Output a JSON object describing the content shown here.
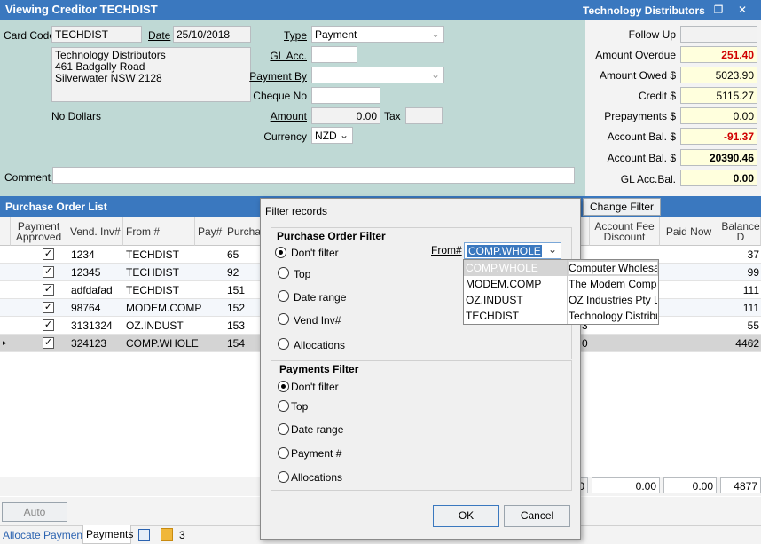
{
  "title": "Viewing Creditor TECHDIST",
  "company": "Technology Distributors",
  "form": {
    "card_code_label": "Card Code",
    "card_code": "TECHDIST",
    "date_label": "Date",
    "date": "25/10/2018",
    "address": [
      "Technology Distributors",
      "461 Badgally Road",
      "Silverwater NSW 2128"
    ],
    "no_dollars": "No Dollars",
    "type_label": "Type",
    "type": "Payment",
    "gl_acc_label": "GL Acc.",
    "payment_by_label": "Payment By",
    "cheque_no_label": "Cheque No",
    "amount_label": "Amount",
    "amount": "0.00",
    "tax_label": "Tax",
    "currency_label": "Currency",
    "currency": "NZD",
    "comment_label": "Comment"
  },
  "summary": [
    {
      "label": "Follow Up",
      "value": ""
    },
    {
      "label": "Amount Overdue",
      "value": "251.40"
    },
    {
      "label": "Amount Owed $",
      "value": "5023.90"
    },
    {
      "label": "Credit $",
      "value": "5115.27"
    },
    {
      "label": "Prepayments $",
      "value": "0.00"
    },
    {
      "label": "Account Bal. $",
      "value": "-91.37"
    },
    {
      "label": "Account Bal. $",
      "value": "20390.46"
    },
    {
      "label": "GL Acc.Bal.",
      "value": "0.00"
    }
  ],
  "po_list": {
    "title": "Purchase Order List",
    "change_filter": "Change Filter",
    "headers": [
      "Payment Approved",
      "Vend. Inv#",
      "From #",
      "Pay#",
      "Purchas",
      "Account Fee Discount",
      "Paid Now",
      "Balance D"
    ],
    "rows": [
      {
        "vend_inv": "1234",
        "from": "TECHDIST",
        "purchase": "65",
        "balance": "37"
      },
      {
        "vend_inv": "12345",
        "from": "TECHDIST",
        "purchase": "92",
        "balance": "99"
      },
      {
        "vend_inv": "adfdafad",
        "from": "TECHDIST",
        "purchase": "151",
        "balance": "111"
      },
      {
        "vend_inv": "98764",
        "from": "MODEM.COMP",
        "purchase": "152",
        "balance": "111"
      },
      {
        "vend_inv": "3131324",
        "from": "OZ.INDUST",
        "purchase": "153",
        "balance": "55"
      },
      {
        "vend_inv": "324123",
        "from": "COMP.WHOLE",
        "purchase": "154",
        "balance": "4462"
      }
    ],
    "selected_row_mid": "0",
    "row5_mid": "3",
    "totals": {
      "fee": "0.00",
      "paid": "0.00",
      "balance": "4877"
    },
    "totals_mid": "0"
  },
  "bottom": {
    "auto_payment": "Auto Payment",
    "tab_allocate": "Allocate Payments",
    "tab_payments": "Payments",
    "count": "3"
  },
  "dialog": {
    "title": "Filter records",
    "po_filter_title": "Purchase Order Filter",
    "po_options": [
      "Don't filter",
      "Top",
      "Date range",
      "Vend Inv#",
      "Allocations"
    ],
    "from_label": "From#",
    "from_value": "COMP.WHOLE",
    "dropdown": [
      {
        "code": "COMP.WHOLE",
        "name": "Computer Wholesale"
      },
      {
        "code": "MODEM.COMP",
        "name": "The Modem Company"
      },
      {
        "code": "OZ.INDUST",
        "name": "OZ Industries Pty Ltd"
      },
      {
        "code": "TECHDIST",
        "name": "Technology Distributors"
      }
    ],
    "pay_filter_title": "Payments Filter",
    "pay_options": [
      "Don't filter",
      "Top",
      "Date range",
      "Payment #",
      "Allocations"
    ],
    "ok": "OK",
    "cancel": "Cancel"
  },
  "colors": {
    "titlebar": "#3a78bf",
    "form_bg": "#bfd9d5",
    "red_value": "#d00000",
    "highlight": "#fffddd"
  }
}
